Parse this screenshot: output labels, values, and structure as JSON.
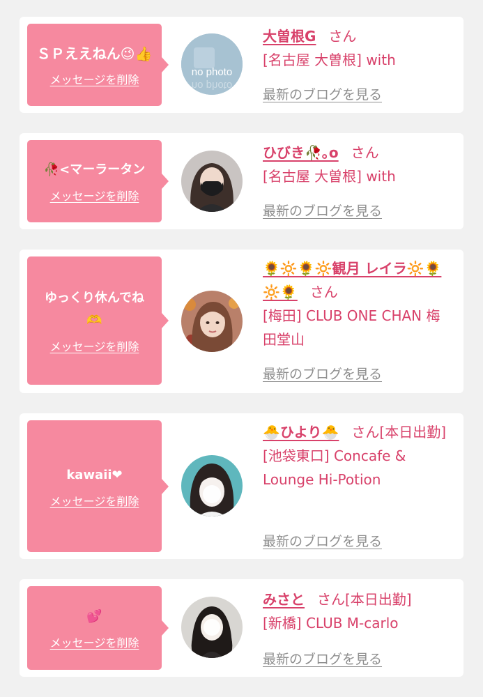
{
  "delete_label": "メッセージを削除",
  "blog_label": "最新のブログを見る",
  "san_label": "さん",
  "colors": {
    "bubble": "#f6899f",
    "accent": "#d8416a",
    "link_gray": "#8f8f8f",
    "background": "#f1f1f1"
  },
  "entries": [
    {
      "message": "ＳＰええねん😉👍",
      "name": "大曽根G",
      "extra": "",
      "shop": "[名古屋 大曽根] with",
      "avatar": "no-photo"
    },
    {
      "message": "🥀<マーラータン",
      "name": "ひびき🥀｡o",
      "extra": "",
      "shop": "[名古屋 大曽根] with",
      "avatar": "masked-woman"
    },
    {
      "message": "ゆっくり休んでね🫶",
      "name": "🌻🔆🌻🔆観月 レイラ🔆🌻🔆🌻",
      "extra": "",
      "shop": "[梅田] CLUB ONE CHAN 梅田堂山",
      "avatar": "woman-flowers"
    },
    {
      "message": "kawaii❤",
      "name": "🐣ひより🐣",
      "extra": "[本日出勤]",
      "shop": "[池袋東口] Concafe & Lounge Hi-Potion",
      "avatar": "woman-teal"
    },
    {
      "message": "💕",
      "name": "みさと",
      "extra": "[本日出勤]",
      "shop": "[新橋] CLUB M-carlo",
      "avatar": "woman-pigtails"
    }
  ]
}
